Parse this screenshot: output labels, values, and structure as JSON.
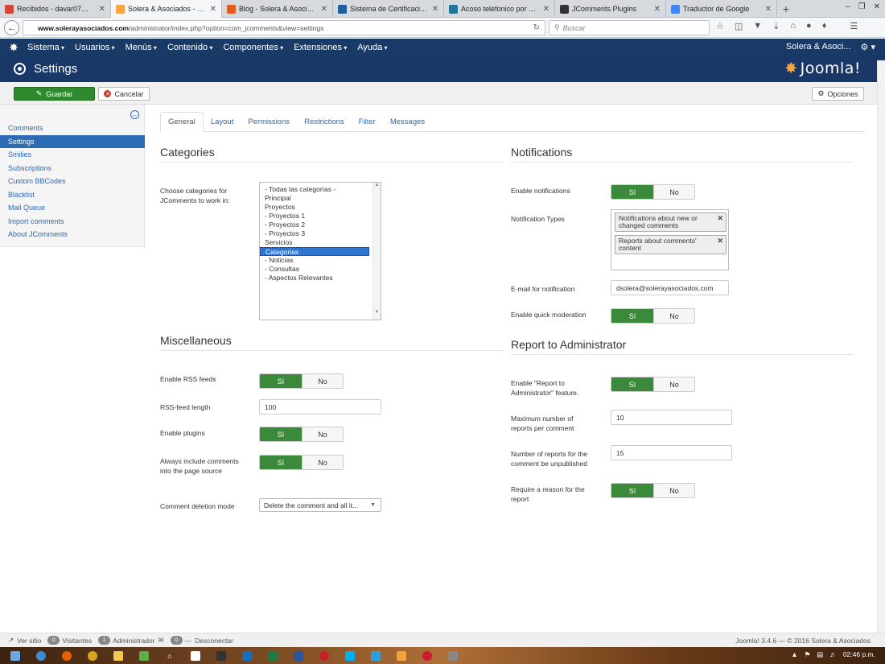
{
  "browser": {
    "tabs": [
      {
        "label": "Recibidos - davar07@g...",
        "color": "#d44638",
        "active": false
      },
      {
        "label": "Solera & Asociados - Ad...",
        "color": "#f9a541",
        "active": true
      },
      {
        "label": "Blog - Solera & Asociados",
        "color": "#e25c1f",
        "active": false
      },
      {
        "label": "Sistema de Certificacion...",
        "color": "#1f5e9c",
        "active": false
      },
      {
        "label": "Acoso telefonico por de...",
        "color": "#21759b",
        "active": false
      },
      {
        "label": "JComments Plugins",
        "color": "#333333",
        "active": false
      },
      {
        "label": "Traductor de Google",
        "color": "#4285f4",
        "active": false
      }
    ],
    "url_domain": "www.solerayasociados.com",
    "url_path": "/administrator/index.php?option=com_jcomments&view=settings",
    "search_placeholder": "Buscar"
  },
  "joomla_menu": {
    "items": [
      "Sistema",
      "Usuarios",
      "Menús",
      "Contenido",
      "Componentes",
      "Extensiones",
      "Ayuda"
    ],
    "site_link": "Solera & Asoci..."
  },
  "header": {
    "title": "Settings",
    "brand": "Joomla!"
  },
  "toolbar": {
    "save_label": "Guardar",
    "cancel_label": "Cancelar",
    "options_label": "Opciones"
  },
  "sidebar": {
    "items": [
      {
        "label": "Comments",
        "active": false
      },
      {
        "label": "Settings",
        "active": true
      },
      {
        "label": "Smilies",
        "active": false
      },
      {
        "label": "Subscriptions",
        "active": false
      },
      {
        "label": "Custom BBCodes",
        "active": false
      },
      {
        "label": "Blacklist",
        "active": false
      },
      {
        "label": "Mail Queue",
        "active": false
      },
      {
        "label": "Import comments",
        "active": false
      },
      {
        "label": "About JComments",
        "active": false
      }
    ]
  },
  "tabs": [
    "General",
    "Layout",
    "Permissions",
    "Restrictions",
    "Filter",
    "Messages"
  ],
  "categories": {
    "title": "Categories",
    "label": "Choose categories for JComments to work in:",
    "options": [
      {
        "label": "- Todas las categorías -",
        "selected": false
      },
      {
        "label": "Principal",
        "selected": false
      },
      {
        "label": "Proyectos",
        "selected": false
      },
      {
        "label": "- Proyectos 1",
        "selected": false
      },
      {
        "label": "- Proyectos 2",
        "selected": false
      },
      {
        "label": "- Proyectos 3",
        "selected": false
      },
      {
        "label": "Servicios",
        "selected": false
      },
      {
        "label": "Categorias",
        "selected": true
      },
      {
        "label": "- Noticias",
        "selected": false
      },
      {
        "label": "- Consultas",
        "selected": false
      },
      {
        "label": "- Aspectos Relevantes",
        "selected": false
      }
    ]
  },
  "misc": {
    "title": "Miscellaneous",
    "rss_label": "Enable RSS feeds",
    "rss_length_label": "RSS-feed length",
    "rss_length_value": "100",
    "plugins_label": "Enable plugins",
    "include_label": "Always include comments into the page source",
    "deletion_label": "Comment deletion mode",
    "deletion_value": "Delete the comment and all it..."
  },
  "notifications": {
    "title": "Notifications",
    "enable_label": "Enable notifications",
    "types_label": "Notification Types",
    "type_chips": [
      "Notifications about new or changed comments",
      "Reports about comments' content"
    ],
    "email_label": "E-mail for notification",
    "email_value": "dsolera@solerayasociados.com",
    "quick_label": "Enable quick moderation"
  },
  "report": {
    "title": "Report to Administrator",
    "enable_label": "Enable \"Report to Administrator\" feature.",
    "max_label": "Maximum number of reports per comment",
    "max_value": "10",
    "unpublish_label": "Number of reports for the comment be unpublished",
    "unpublish_value": "15",
    "reason_label": "Require a reason for the report"
  },
  "toggle": {
    "yes": "Sí",
    "no": "No"
  },
  "status": {
    "view_site": "Ver sitio",
    "visitors_count": "0",
    "visitors_label": "Visitantes",
    "admin_count": "1",
    "admin_label": "Administrador",
    "msg_count": "0",
    "logout": "Desconectar",
    "version": "Joomla! 3.4.6 — © 2016 Solera & Asociados"
  },
  "taskbar": {
    "clock": "02:46 p.m."
  }
}
